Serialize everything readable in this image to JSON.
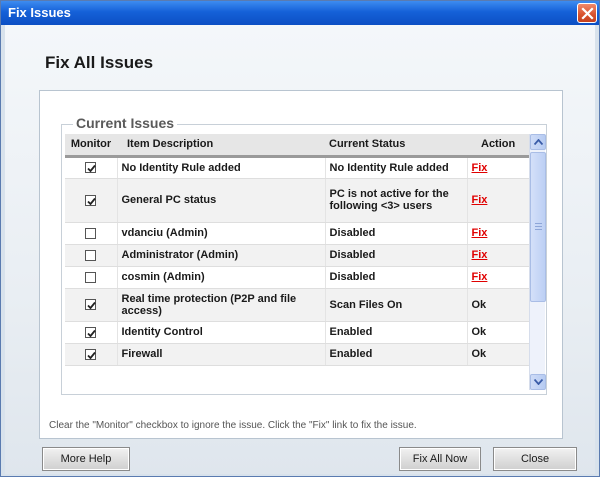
{
  "window": {
    "title": "Fix Issues",
    "close_icon": "close-icon",
    "accent_color": "#1561d8",
    "close_color": "#d8512c"
  },
  "heading": "Fix All Issues",
  "group_title": "Current Issues",
  "columns": {
    "monitor": "Monitor",
    "description": "Item Description",
    "status": "Current Status",
    "action": "Action"
  },
  "rows": [
    {
      "monitor": true,
      "description": "No Identity Rule added",
      "status": "No Identity Rule added",
      "action": "Fix"
    },
    {
      "monitor": true,
      "description": "General PC status",
      "status": "PC is not active for the following <3> users",
      "action": "Fix"
    },
    {
      "monitor": false,
      "description": "vdanciu (Admin)",
      "status": "Disabled",
      "action": "Fix"
    },
    {
      "monitor": false,
      "description": "Administrator (Admin)",
      "status": "Disabled",
      "action": "Fix"
    },
    {
      "monitor": false,
      "description": "cosmin (Admin)",
      "status": "Disabled",
      "action": "Fix"
    },
    {
      "monitor": true,
      "description": "Real time protection (P2P and file access)",
      "status": "Scan Files On",
      "action": "Ok"
    },
    {
      "monitor": true,
      "description": "Identity Control",
      "status": "Enabled",
      "action": "Ok"
    },
    {
      "monitor": true,
      "description": "Firewall",
      "status": "Enabled",
      "action": "Ok"
    }
  ],
  "link_color": "#e00000",
  "hint": "Clear the \"Monitor\" checkbox to ignore the issue. Click the \"Fix\" link to fix the issue.",
  "buttons": {
    "more_help": "More Help",
    "fix_all_now": "Fix All Now",
    "close": "Close"
  }
}
